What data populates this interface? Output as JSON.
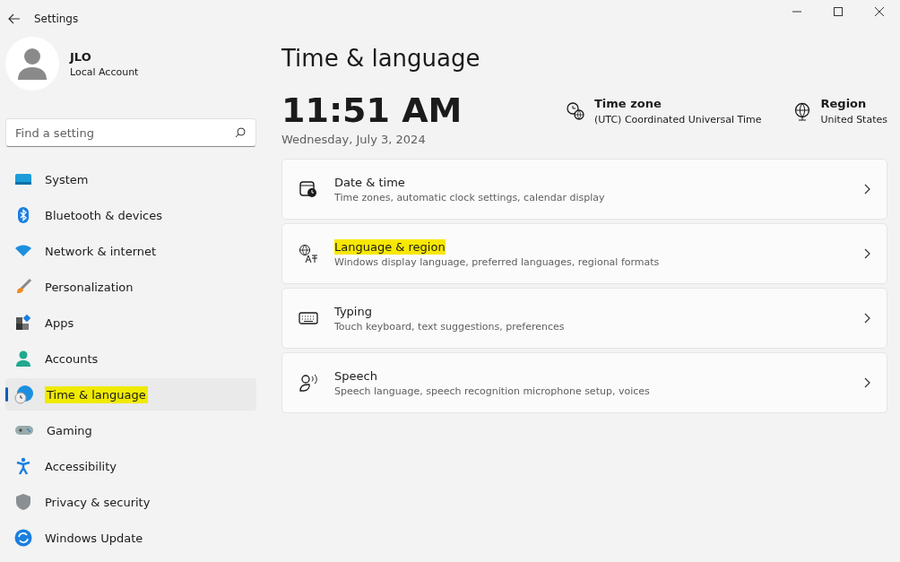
{
  "window": {
    "title": "Settings"
  },
  "account": {
    "name": "JLO",
    "type": "Local Account"
  },
  "search": {
    "placeholder": "Find a setting"
  },
  "sidebar": {
    "items": [
      {
        "label": "System",
        "selected": false,
        "highlighted": false
      },
      {
        "label": "Bluetooth & devices",
        "selected": false,
        "highlighted": false
      },
      {
        "label": "Network & internet",
        "selected": false,
        "highlighted": false
      },
      {
        "label": "Personalization",
        "selected": false,
        "highlighted": false
      },
      {
        "label": "Apps",
        "selected": false,
        "highlighted": false
      },
      {
        "label": "Accounts",
        "selected": false,
        "highlighted": false
      },
      {
        "label": "Time & language",
        "selected": true,
        "highlighted": true
      },
      {
        "label": "Gaming",
        "selected": false,
        "highlighted": false
      },
      {
        "label": "Accessibility",
        "selected": false,
        "highlighted": false
      },
      {
        "label": "Privacy & security",
        "selected": false,
        "highlighted": false
      },
      {
        "label": "Windows Update",
        "selected": false,
        "highlighted": false
      }
    ]
  },
  "page": {
    "title": "Time & language",
    "time": "11:51 AM",
    "date": "Wednesday, July 3, 2024",
    "info": [
      {
        "label": "Time zone",
        "value": "(UTC) Coordinated Universal Time"
      },
      {
        "label": "Region",
        "value": "United States"
      }
    ],
    "cards": [
      {
        "title": "Date & time",
        "subtitle": "Time zones, automatic clock settings, calendar display",
        "highlighted": false
      },
      {
        "title": "Language & region",
        "subtitle": "Windows display language, preferred languages, regional formats",
        "highlighted": true
      },
      {
        "title": "Typing",
        "subtitle": "Touch keyboard, text suggestions, preferences",
        "highlighted": false
      },
      {
        "title": "Speech",
        "subtitle": "Speech language, speech recognition microphone setup, voices",
        "highlighted": false
      }
    ]
  }
}
